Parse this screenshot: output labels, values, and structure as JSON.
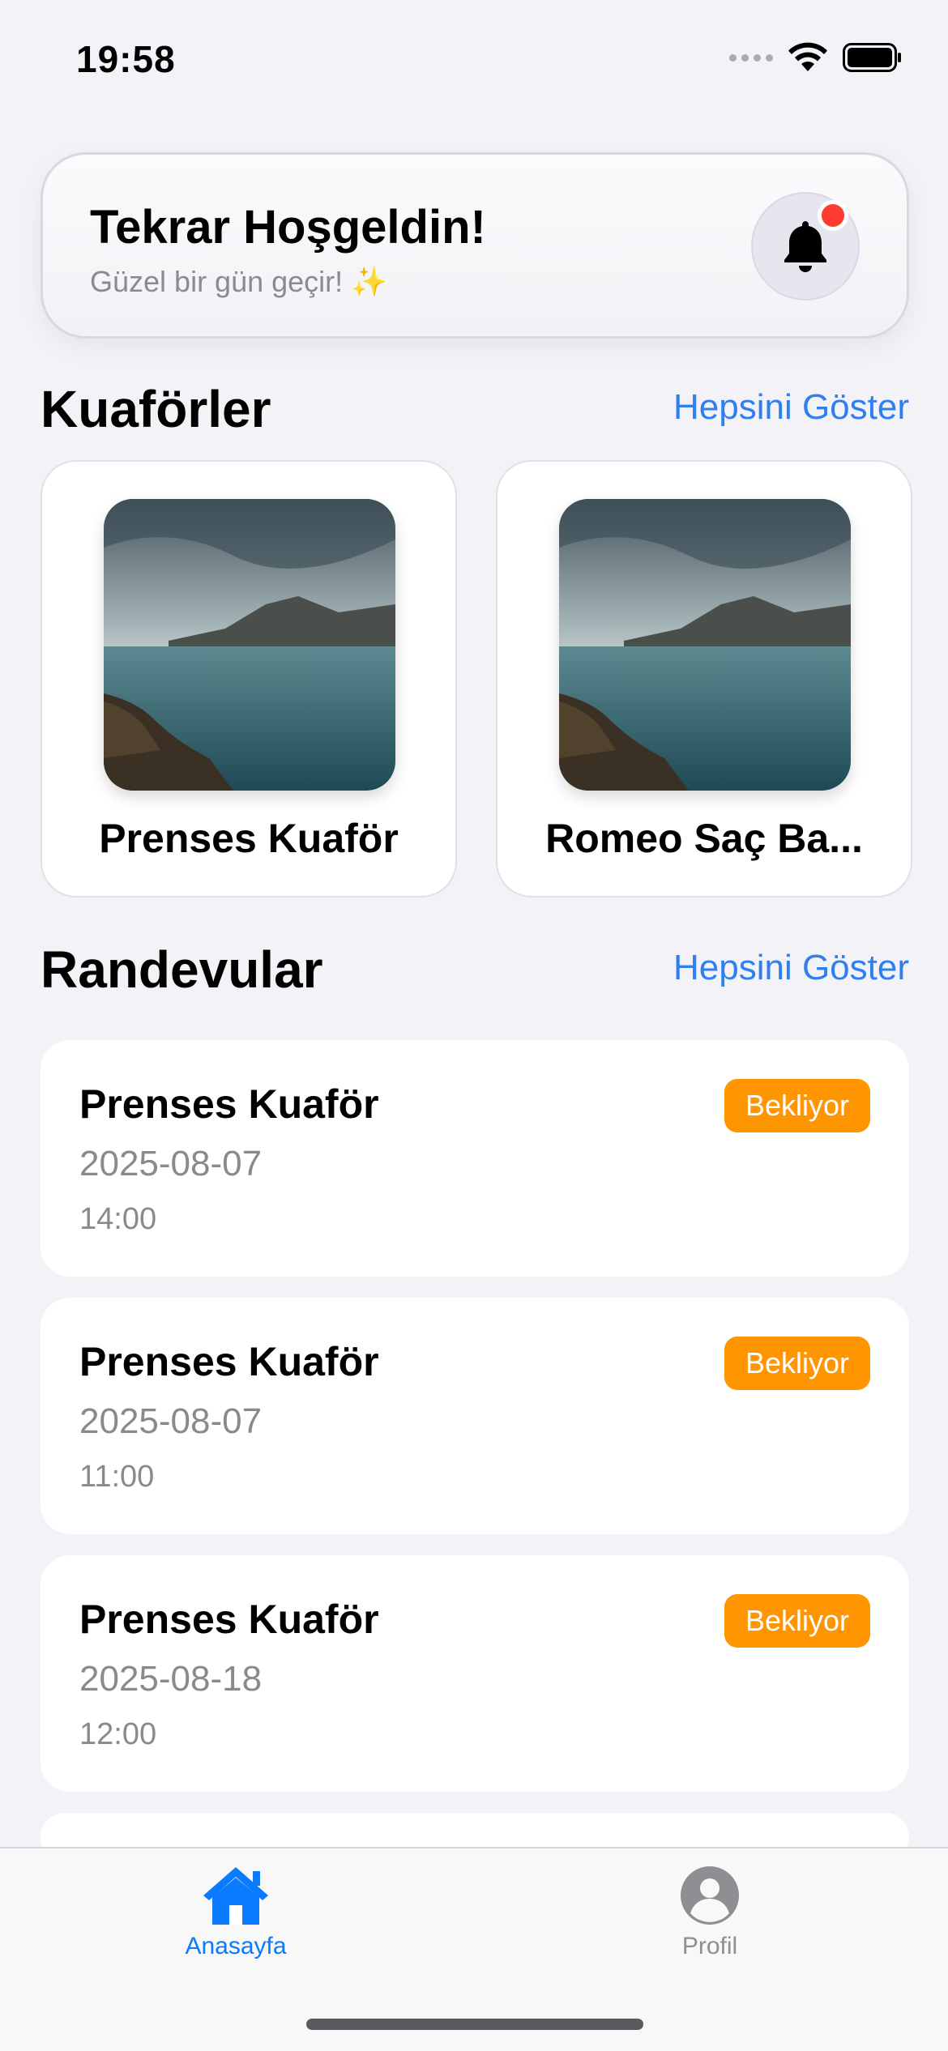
{
  "status_bar": {
    "time": "19:58"
  },
  "welcome": {
    "title": "Tekrar Hoşgeldin!",
    "subtitle": "Güzel bir gün geçir! ✨"
  },
  "salons_section": {
    "title": "Kuaförler",
    "show_all": "Hepsini Göster",
    "items": [
      {
        "name": "Prenses Kuaför"
      },
      {
        "name": "Romeo Saç Ba..."
      }
    ]
  },
  "appointments_section": {
    "title": "Randevular",
    "show_all": "Hepsini Göster",
    "items": [
      {
        "salon": "Prenses Kuaför",
        "date": "2025-08-07",
        "time": "14:00",
        "status": "Bekliyor"
      },
      {
        "salon": "Prenses Kuaför",
        "date": "2025-08-07",
        "time": "11:00",
        "status": "Bekliyor"
      },
      {
        "salon": "Prenses Kuaför",
        "date": "2025-08-18",
        "time": "12:00",
        "status": "Bekliyor"
      }
    ]
  },
  "tab_bar": {
    "items": [
      {
        "label": "Anasayfa",
        "icon": "home-icon",
        "active": true
      },
      {
        "label": "Profil",
        "icon": "profile-icon",
        "active": false
      }
    ]
  },
  "colors": {
    "accent": "#2f7ff0",
    "tab_active": "#0a7aff",
    "status_pending": "#ff9500",
    "notification": "#ff3b30"
  }
}
